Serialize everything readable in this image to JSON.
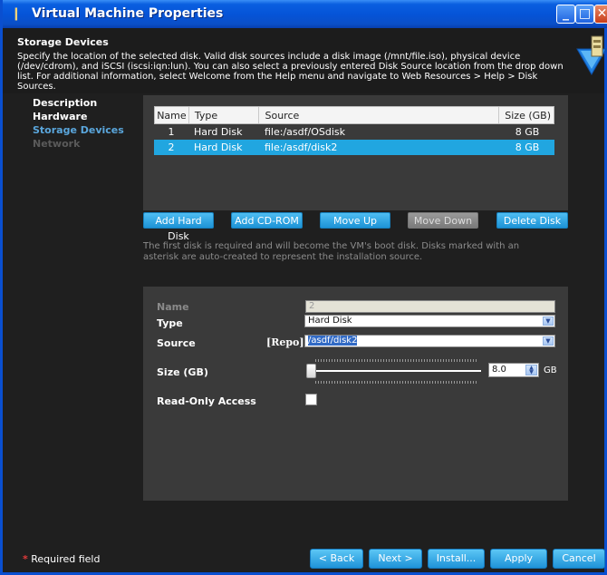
{
  "window": {
    "title": "Virtual Machine Properties",
    "controls": {
      "minimize": "_",
      "maximize": "□",
      "close": "✕"
    }
  },
  "header": {
    "title": "Storage Devices",
    "description": "Specify the location of the selected disk. Valid disk sources include a disk image (/mnt/file.iso), physical device (/dev/cdrom), and iSCSI (iscsi:iqn:lun).  You can also select a previously entered Disk Source location from the drop down list.  For additional information, select Welcome from the Help menu and navigate to Web Resources > Help > Disk Sources.",
    "icon": "disk-download-icon"
  },
  "nav": {
    "items": [
      {
        "label": "Description",
        "state": "normal"
      },
      {
        "label": "Hardware",
        "state": "normal"
      },
      {
        "label": "Storage Devices",
        "state": "active"
      },
      {
        "label": "Network",
        "state": "disabled"
      }
    ]
  },
  "disk_table": {
    "columns": [
      "Name",
      "Type",
      "Source",
      "Size (GB)"
    ],
    "rows": [
      {
        "name": "1",
        "type": "Hard Disk",
        "source": "file:/asdf/OSdisk",
        "size": "8 GB",
        "selected": false
      },
      {
        "name": "2",
        "type": "Hard Disk",
        "source": "file:/asdf/disk2",
        "size": "8 GB",
        "selected": true
      }
    ]
  },
  "actions": {
    "add_hard_disk": "Add Hard Disk",
    "add_cdrom": "Add CD-ROM",
    "move_up": "Move Up",
    "move_down": "Move Down",
    "delete_disk": "Delete Disk"
  },
  "note": "The first disk is required and will become the VM's boot disk. Disks marked with an asterisk are auto-created to represent the installation source.",
  "editor": {
    "name_label": "Name",
    "name_value": "2",
    "type_label": "Type",
    "type_value": "Hard Disk",
    "source_label": "Source",
    "repo_prefix": "[Repo]:",
    "source_value": "/asdf/disk2",
    "size_label": "Size (GB)",
    "size_value": "8.0",
    "size_slider_fraction": 0.0,
    "size_unit": "GB",
    "readonly_label": "Read-Only Access",
    "readonly_checked": false
  },
  "footer": {
    "required_star": "*",
    "required_text": "Required field",
    "back": "< Back",
    "next": "Next >",
    "install": "Install...",
    "apply": "Apply",
    "cancel": "Cancel"
  },
  "colors": {
    "title_bar": "#0554d8",
    "accent_blue": "#21a6e0",
    "panel_bg": "#3a3a3a",
    "window_bg": "#1f1f1f",
    "nav_active": "#5aa6dc"
  }
}
